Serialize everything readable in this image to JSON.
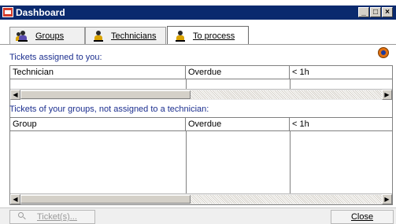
{
  "window": {
    "title": "Dashboard",
    "controls": [
      "minimize",
      "maximize",
      "close"
    ]
  },
  "tabs": [
    {
      "label": "Groups",
      "icon": "group-icon",
      "active": false
    },
    {
      "label": "Technicians",
      "icon": "technician-icon",
      "active": false
    },
    {
      "label": "To process",
      "icon": "to-process-icon",
      "active": true
    }
  ],
  "section1": {
    "label": "Tickets assigned to you:",
    "columns": [
      "Technician",
      "Overdue",
      "< 1h"
    ]
  },
  "section2": {
    "label": "Tickets of your groups, not assigned to a technician:",
    "columns": [
      "Group",
      "Overdue",
      "< 1h"
    ]
  },
  "footer": {
    "tickets_label": "Ticket(s)...",
    "close_label": "Close"
  },
  "colors": {
    "titlebar": "#0a2a6e",
    "section_label": "#1c2f8f"
  }
}
